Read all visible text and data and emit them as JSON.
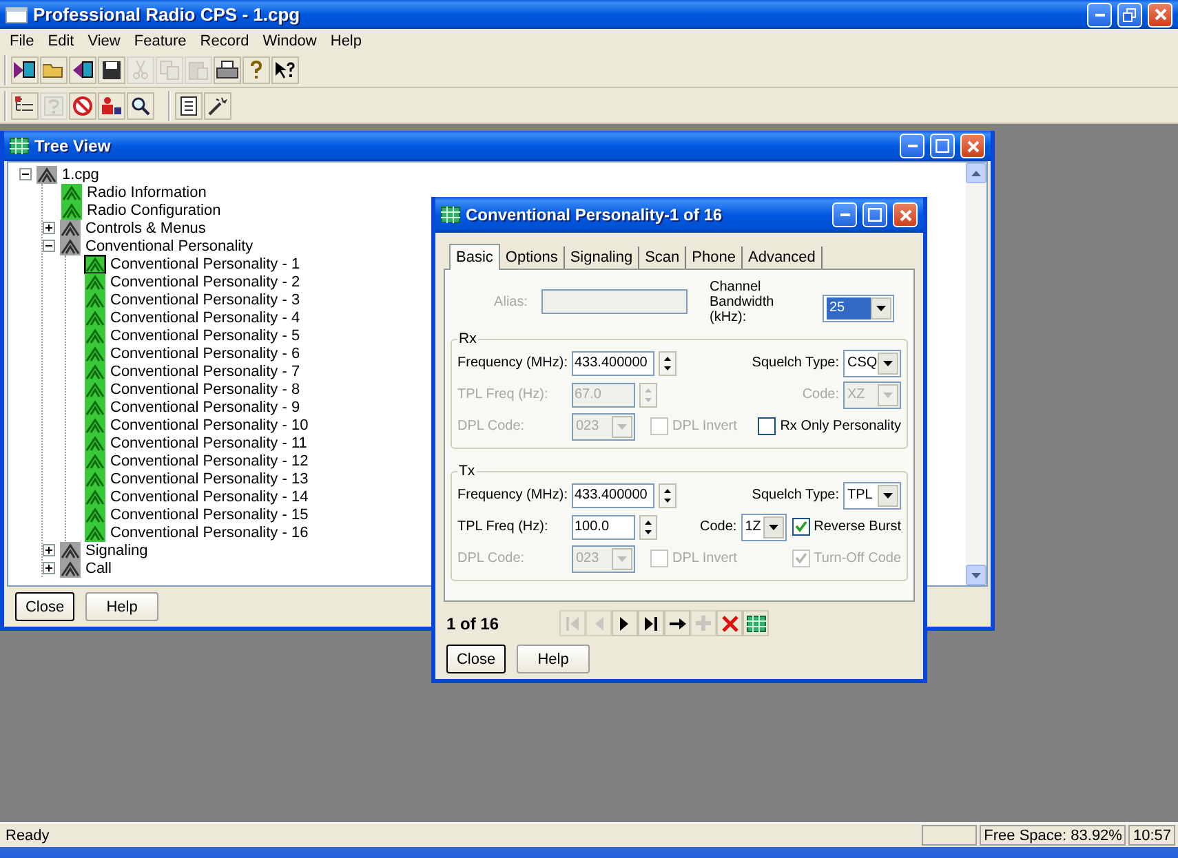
{
  "window": {
    "title": "Professional Radio CPS - 1.cpg"
  },
  "menu": [
    "File",
    "Edit",
    "View",
    "Feature",
    "Record",
    "Window",
    "Help"
  ],
  "toolbars": [
    [
      [
        {
          "kind": "read",
          "disabled": false
        },
        {
          "kind": "open",
          "disabled": false
        },
        {
          "kind": "write",
          "disabled": false
        },
        {
          "kind": "save",
          "disabled": false
        },
        {
          "kind": "cut",
          "disabled": true
        },
        {
          "kind": "copy",
          "disabled": true
        },
        {
          "kind": "paste",
          "disabled": true
        },
        {
          "kind": "print",
          "disabled": false
        },
        {
          "kind": "help",
          "disabled": false
        },
        {
          "kind": "whats-this",
          "disabled": false
        }
      ]
    ],
    [
      [
        {
          "kind": "tree",
          "disabled": false
        },
        {
          "kind": "info",
          "disabled": true
        },
        {
          "kind": "block",
          "disabled": false
        },
        {
          "kind": "people",
          "disabled": false
        },
        {
          "kind": "search",
          "disabled": false
        }
      ],
      [
        {
          "kind": "document",
          "disabled": false
        },
        {
          "kind": "wand",
          "disabled": false
        }
      ]
    ]
  ],
  "tree_view": {
    "title": "Tree View",
    "items": [
      {
        "label": "1.cpg",
        "expanded": true,
        "selected": false,
        "children": [
          {
            "label": "Radio Information",
            "selected": false
          },
          {
            "label": "Radio Configuration",
            "selected": false
          },
          {
            "label": "Controls & Menus",
            "expanded": false,
            "selected": false
          },
          {
            "label": "Conventional Personality",
            "expanded": true,
            "selected": false,
            "children": [
              {
                "label": "Conventional Personality - 1",
                "selected": true
              },
              {
                "label": "Conventional Personality - 2",
                "selected": false
              },
              {
                "label": "Conventional Personality - 3",
                "selected": false
              },
              {
                "label": "Conventional Personality - 4",
                "selected": false
              },
              {
                "label": "Conventional Personality - 5",
                "selected": false
              },
              {
                "label": "Conventional Personality - 6",
                "selected": false
              },
              {
                "label": "Conventional Personality - 7",
                "selected": false
              },
              {
                "label": "Conventional Personality - 8",
                "selected": false
              },
              {
                "label": "Conventional Personality - 9",
                "selected": false
              },
              {
                "label": "Conventional Personality - 10",
                "selected": false
              },
              {
                "label": "Conventional Personality - 11",
                "selected": false
              },
              {
                "label": "Conventional Personality - 12",
                "selected": false
              },
              {
                "label": "Conventional Personality - 13",
                "selected": false
              },
              {
                "label": "Conventional Personality - 14",
                "selected": false
              },
              {
                "label": "Conventional Personality - 15",
                "selected": false
              },
              {
                "label": "Conventional Personality - 16",
                "selected": false
              }
            ]
          },
          {
            "label": "Signaling",
            "expanded": false,
            "selected": false
          },
          {
            "label": "Call",
            "expanded": false,
            "selected": false
          }
        ]
      }
    ],
    "buttons": [
      "Close",
      "Help"
    ]
  },
  "dialog": {
    "title": "Conventional Personality-1 of 16",
    "tabs": [
      {
        "label": "Basic",
        "selected": true
      },
      {
        "label": "Options",
        "selected": false
      },
      {
        "label": "Signaling",
        "selected": false
      },
      {
        "label": "Scan",
        "selected": false
      },
      {
        "label": "Phone",
        "selected": false
      },
      {
        "label": "Advanced",
        "selected": false
      }
    ],
    "alias": {
      "label": "Alias:",
      "disabled": true
    },
    "channel_bandwidth": {
      "label": "Channel Bandwidth (kHz):",
      "value": "25",
      "focused": true
    },
    "groups": [
      {
        "title": "Rx",
        "rows": [
          [
            {
              "kind": "spin",
              "label": "Frequency (MHz):",
              "value": "433.400000",
              "disabled": false
            },
            {
              "kind": "combo",
              "label": "Squelch Type:",
              "value": "CSQ",
              "disabled": false
            }
          ],
          [
            {
              "kind": "spin",
              "label": "TPL Freq (Hz):",
              "value": "67.0",
              "disabled": true
            },
            {
              "kind": "combo",
              "label": "Code:",
              "value": "XZ",
              "disabled": true
            }
          ],
          [
            {
              "kind": "combo",
              "label": "DPL Code:",
              "value": "023",
              "disabled": true
            },
            {
              "kind": "checkbox",
              "label": "DPL Invert",
              "checked": false,
              "disabled": true
            },
            {
              "kind": "checkbox",
              "label": "Rx Only Personality",
              "checked": false,
              "disabled": false
            }
          ]
        ]
      },
      {
        "title": "Tx",
        "rows": [
          [
            {
              "kind": "spin",
              "label": "Frequency (MHz):",
              "value": "433.400000",
              "disabled": false
            },
            {
              "kind": "combo",
              "label": "Squelch Type:",
              "value": "TPL",
              "disabled": false
            }
          ],
          [
            {
              "kind": "spin",
              "label": "TPL Freq (Hz):",
              "value": "100.0",
              "disabled": false
            },
            {
              "kind": "combo",
              "label": "Code:",
              "value": "1Z",
              "disabled": false
            },
            {
              "kind": "checkbox",
              "label": "Reverse Burst",
              "checked": true,
              "disabled": false
            }
          ],
          [
            {
              "kind": "combo",
              "label": "DPL Code:",
              "value": "023",
              "disabled": true
            },
            {
              "kind": "checkbox",
              "label": "DPL Invert",
              "checked": false,
              "disabled": true
            },
            {
              "kind": "checkbox",
              "label": "Turn-Off Code",
              "checked": true,
              "disabled": true
            }
          ]
        ]
      }
    ],
    "counter": "1 of 16",
    "nav": [
      {
        "kind": "first",
        "disabled": true
      },
      {
        "kind": "prev",
        "disabled": true
      },
      {
        "kind": "next",
        "disabled": false
      },
      {
        "kind": "last",
        "disabled": false
      },
      {
        "kind": "goto",
        "disabled": false
      },
      {
        "kind": "add",
        "disabled": true
      },
      {
        "kind": "delete",
        "disabled": false
      },
      {
        "kind": "grid",
        "disabled": false
      }
    ],
    "buttons": [
      "Close",
      "Help"
    ]
  },
  "status_bar": {
    "message": "Ready",
    "free_space": "Free Space: 83.92%",
    "time": "10:57"
  }
}
